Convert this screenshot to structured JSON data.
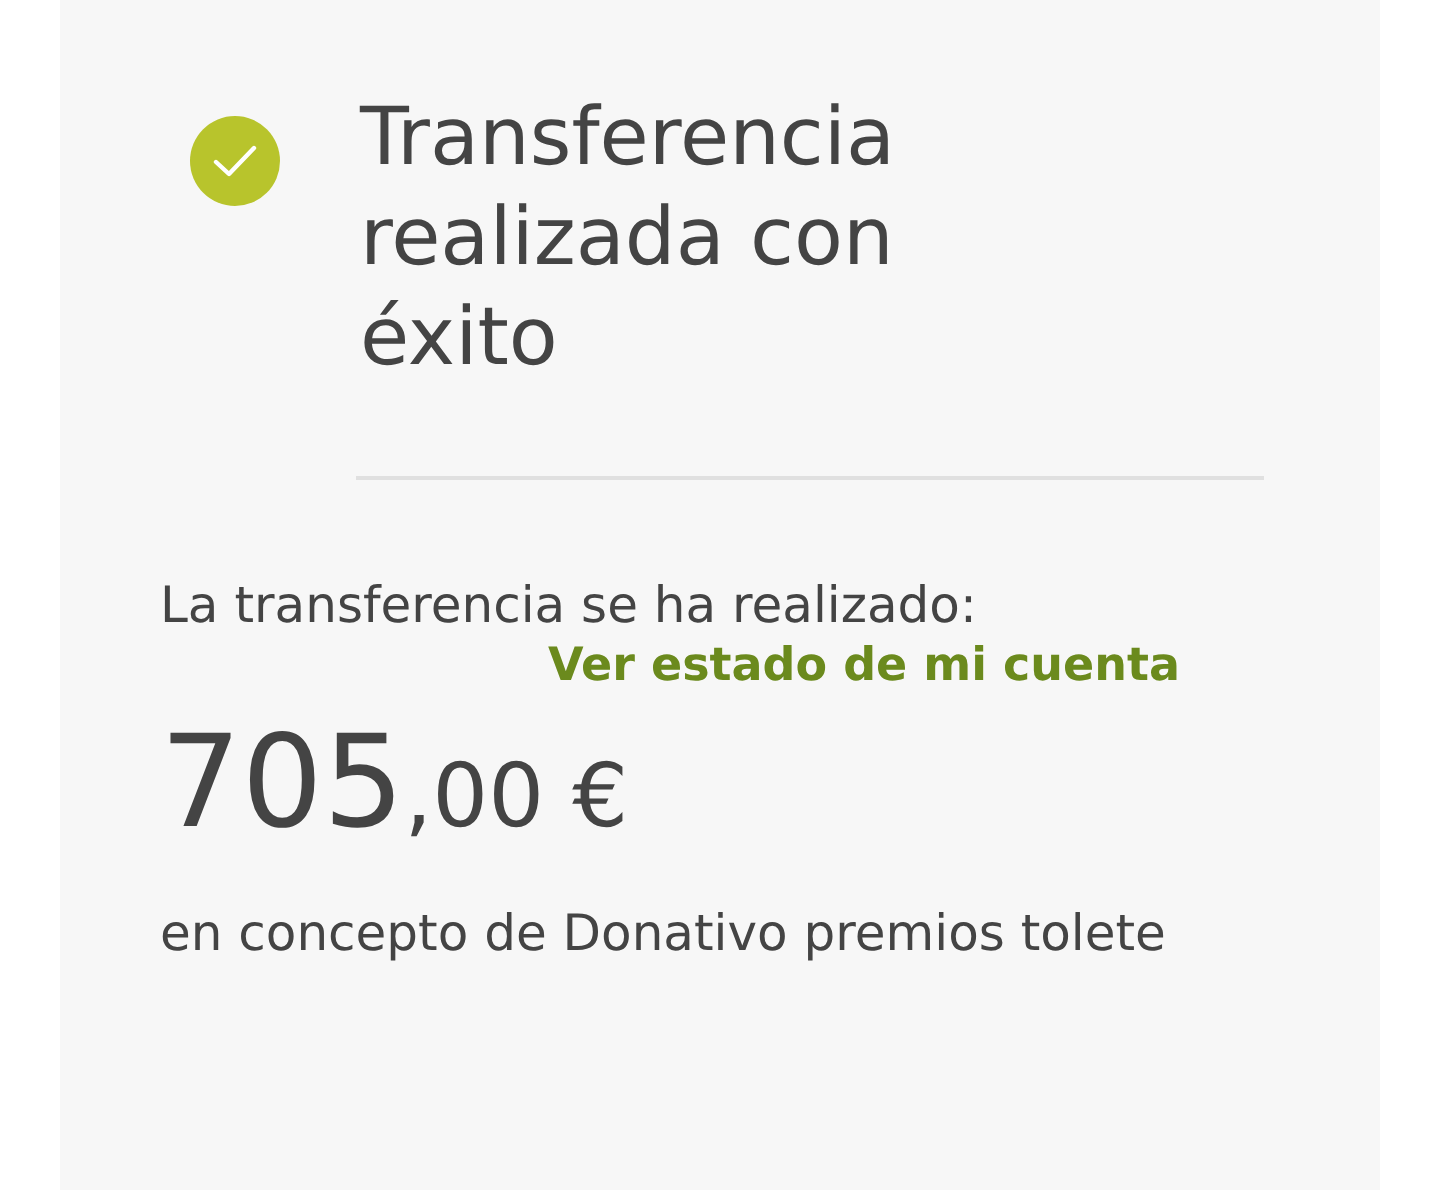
{
  "header": {
    "title": "Transferencia realizada con éxito"
  },
  "message": "La transferencia se ha realizado:",
  "account_link": "Ver estado de mi cuenta",
  "amount": {
    "integer": "705",
    "fraction": ",00 €"
  },
  "concept": "en concepto de Donativo premios tolete"
}
